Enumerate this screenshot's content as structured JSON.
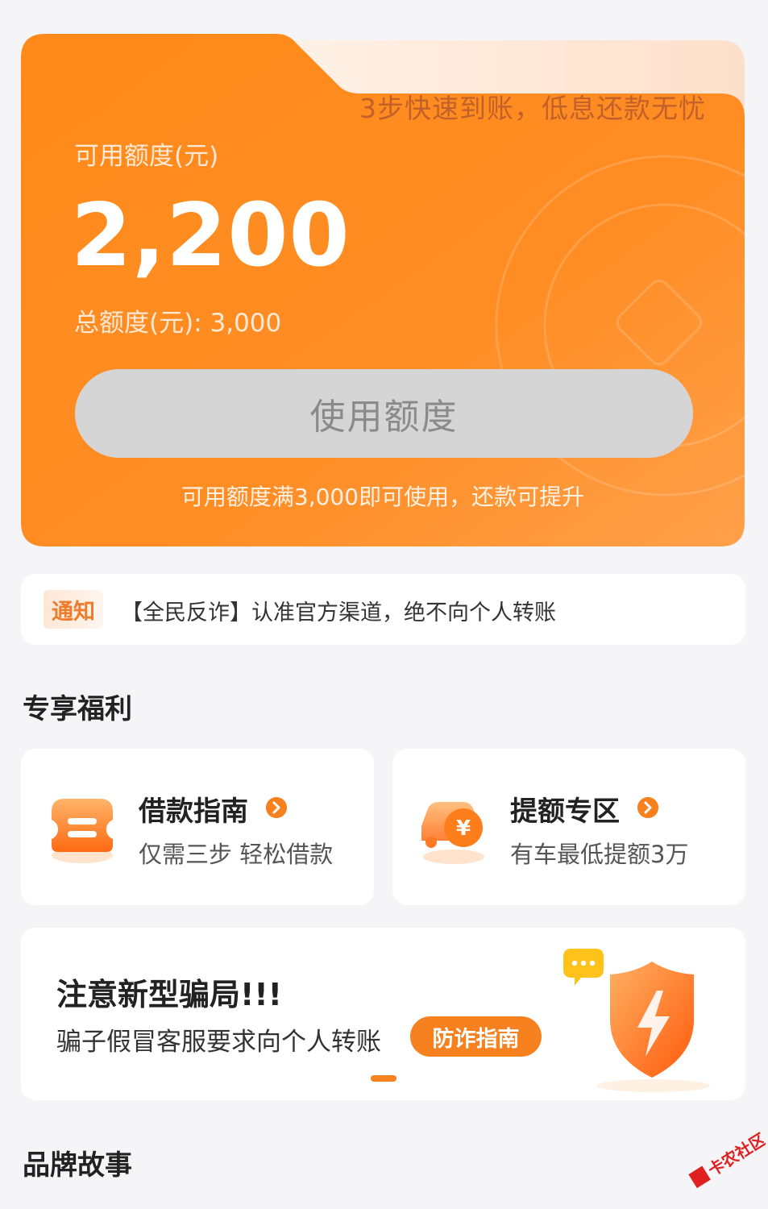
{
  "credit_card": {
    "slogan": "3步快速到账，低息还款无忧",
    "available_label": "可用额度(元)",
    "available_amount": "2,200",
    "total_label": "总额度(元): 3,000",
    "use_button_label": "使用额度",
    "hint": "可用额度满3,000即可使用，还款可提升"
  },
  "notice": {
    "tag": "通知",
    "text": "【全民反诈】认准官方渠道，绝不向个人转账"
  },
  "benefits": {
    "section_title": "专享福利",
    "items": [
      {
        "title": "借款指南",
        "subtitle": "仅需三步 轻松借款",
        "icon": "ticket-icon"
      },
      {
        "title": "提额专区",
        "subtitle": "有车最低提额3万",
        "icon": "car-yuan-icon"
      }
    ]
  },
  "fraud_banner": {
    "title": "注意新型骗局!!!",
    "text": "骗子假冒客服要求向个人转账",
    "button_label": "防诈指南",
    "icon": "shield-lightning-icon"
  },
  "brand": {
    "section_title": "品牌故事"
  },
  "colors": {
    "accent": "#f7801f",
    "card_orange": "#ff8a1f"
  }
}
